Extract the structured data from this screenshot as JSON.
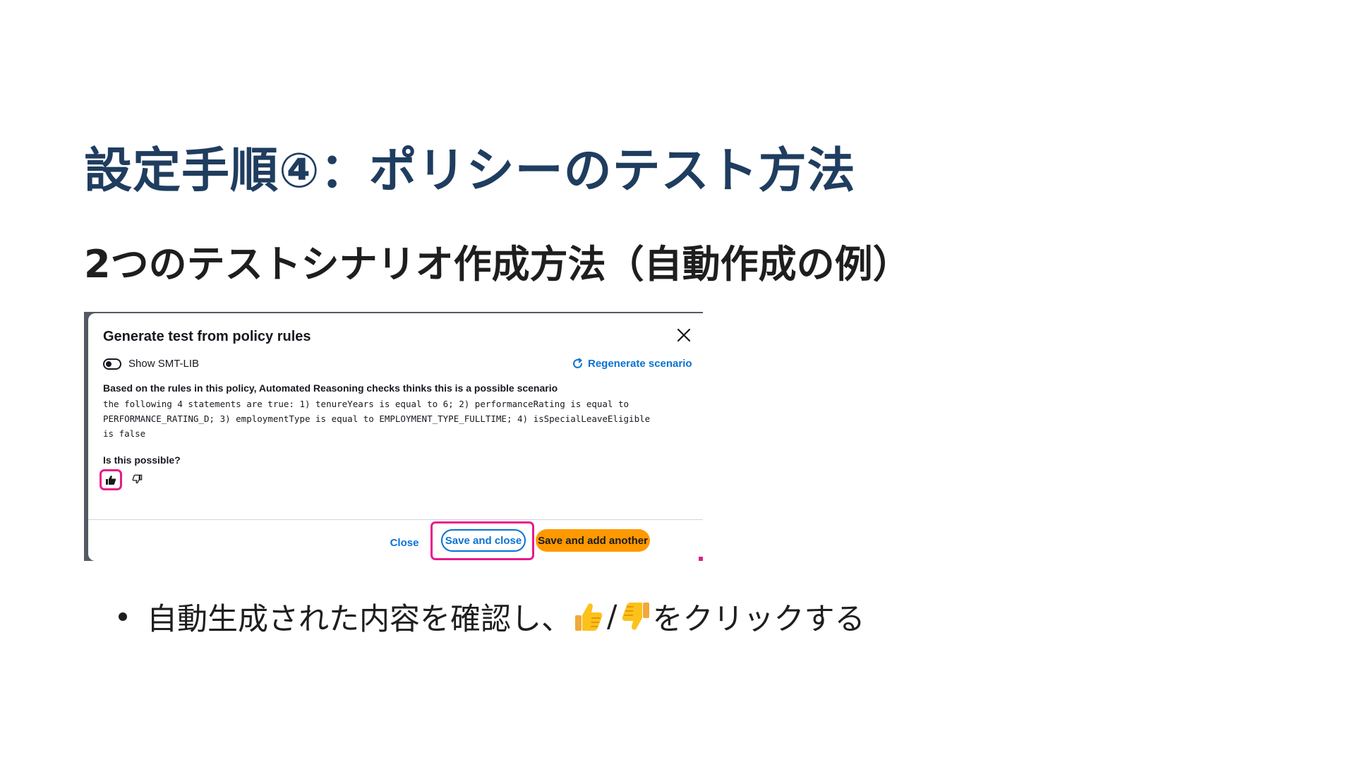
{
  "slide": {
    "title": "設定手順④：ポリシーのテスト方法",
    "subtitle": "2つのテストシナリオ作成方法（自動作成の例）",
    "bullet": {
      "before": "自動生成された内容を確認し、",
      "emoji_up": "thumbs-up-emoji",
      "slash": "/",
      "emoji_down": "thumbs-down-emoji",
      "after": "をクリックする"
    }
  },
  "modal": {
    "title": "Generate test from policy rules",
    "close_icon": "close-icon",
    "toggle_label": "Show SMT-LIB",
    "toggle_on": false,
    "regenerate_label": "Regenerate scenario",
    "regenerate_icon": "refresh-icon",
    "scenario_heading": "Based on the rules in this policy, Automated Reasoning checks thinks this is a possible scenario",
    "scenario_lines": [
      "the following 4 statements are true: 1) tenureYears is equal to 6; 2) performanceRating is equal to",
      "PERFORMANCE_RATING_D; 3) employmentType is equal to EMPLOYMENT_TYPE_FULLTIME; 4) isSpecialLeaveEligible",
      "is false"
    ],
    "question": "Is this possible?",
    "thumb_up_icon": "thumb-up-icon",
    "thumb_down_icon": "thumb-down-icon",
    "buttons": {
      "close": "Close",
      "save_close": "Save and close",
      "save_add": "Save and add another"
    }
  },
  "colors": {
    "title": "#1f3d5f",
    "text": "#1e1e1e",
    "link": "#0972d3",
    "primary_button": "#ff9900",
    "highlight": "#e8198b"
  }
}
